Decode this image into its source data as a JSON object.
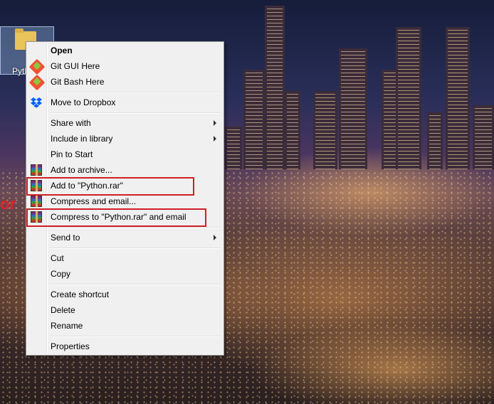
{
  "desktop": {
    "icon_label": "Pyth",
    "annotation_text": "or"
  },
  "context_menu": {
    "items": [
      {
        "label": "Open",
        "icon": "none",
        "bold": true
      },
      {
        "label": "Git GUI Here",
        "icon": "git-icon"
      },
      {
        "label": "Git Bash Here",
        "icon": "git-icon"
      },
      {
        "label": "Move to Dropbox",
        "icon": "dropbox-icon"
      },
      {
        "label": "Share with",
        "icon": "none",
        "submenu": true
      },
      {
        "label": "Include in library",
        "icon": "none",
        "submenu": true
      },
      {
        "label": "Pin to Start",
        "icon": "none"
      },
      {
        "label": "Add to archive...",
        "icon": "winrar-icon"
      },
      {
        "label": "Add to \"Python.rar\"",
        "icon": "winrar-icon",
        "highlighted": true
      },
      {
        "label": "Compress and email...",
        "icon": "winrar-icon"
      },
      {
        "label": "Compress to \"Python.rar\" and email",
        "icon": "winrar-icon",
        "highlighted": true
      },
      {
        "label": "Send to",
        "icon": "none",
        "submenu": true
      },
      {
        "label": "Cut",
        "icon": "none"
      },
      {
        "label": "Copy",
        "icon": "none"
      },
      {
        "label": "Create shortcut",
        "icon": "none"
      },
      {
        "label": "Delete",
        "icon": "none"
      },
      {
        "label": "Rename",
        "icon": "none"
      },
      {
        "label": "Properties",
        "icon": "none"
      }
    ]
  },
  "colors": {
    "highlight_border": "#d01f26",
    "menu_background": "#f0f0f0",
    "dropbox_blue": "#0061fe"
  }
}
